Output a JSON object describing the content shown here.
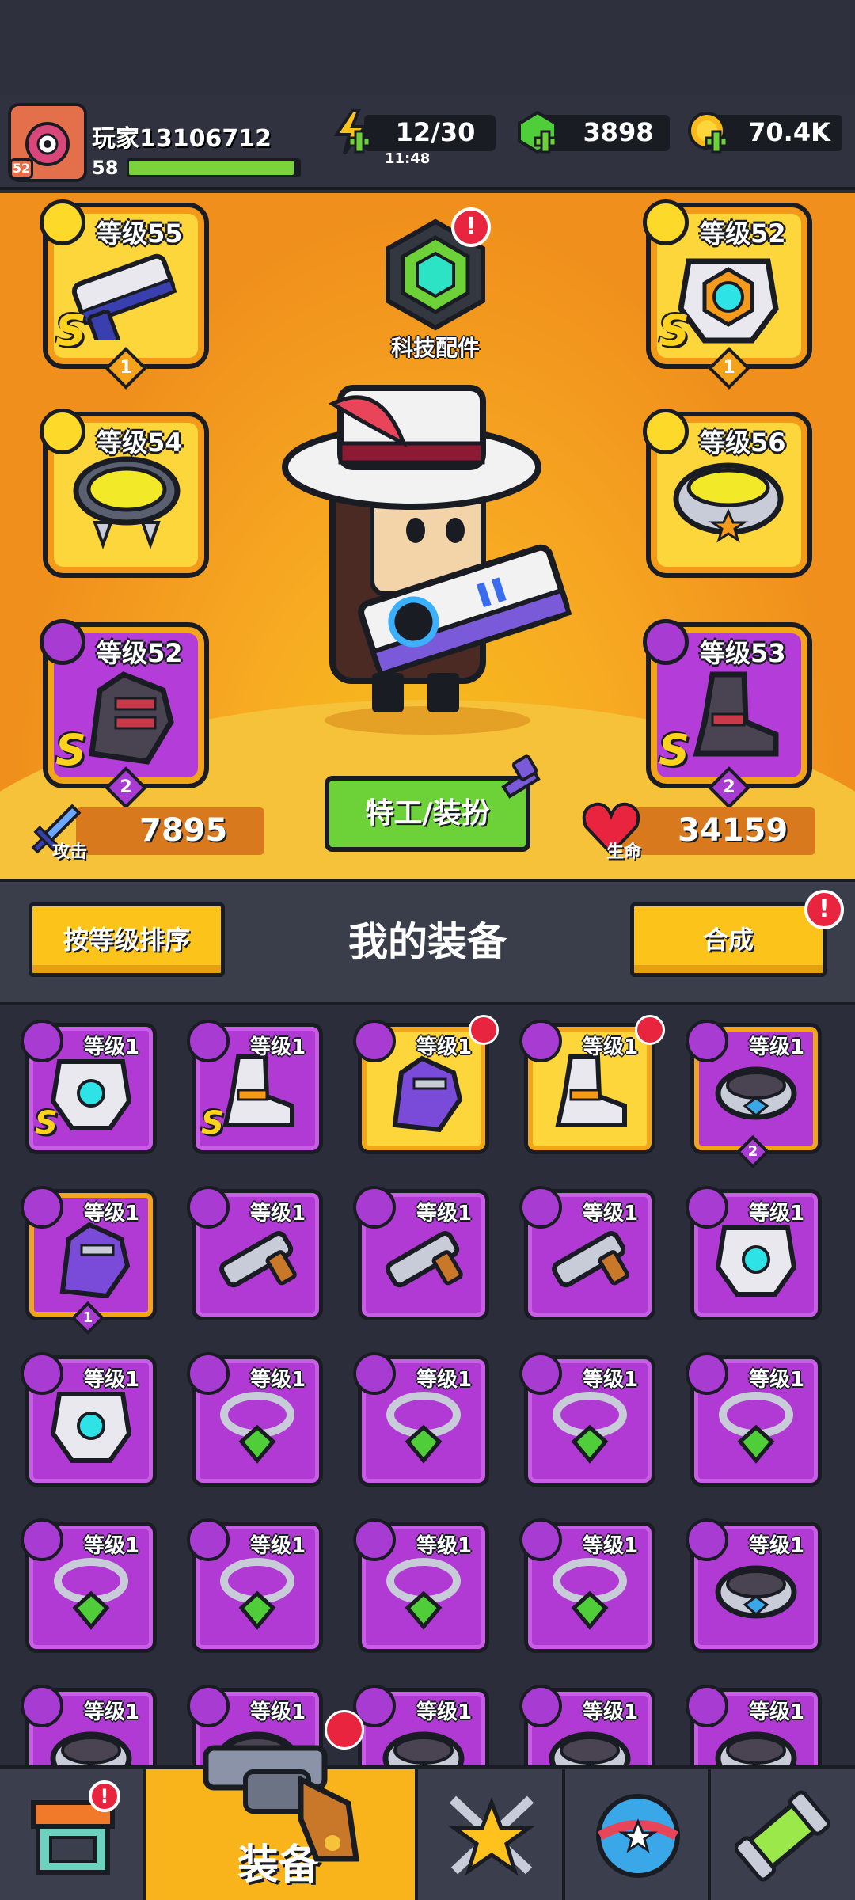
{
  "player": {
    "name": "玩家13106712",
    "level": "58",
    "avatar_level": "52",
    "xp_fraction": 0.97
  },
  "resources": {
    "energy": "12/30",
    "energy_timer": "11:48",
    "gems": "3898",
    "coins": "70.4K"
  },
  "tech_parts": {
    "label": "科技配件",
    "alert": "!"
  },
  "slots": {
    "weapon": {
      "label": "等级55",
      "grade": "S",
      "stars": "1"
    },
    "armor": {
      "label": "等级52",
      "grade": "S",
      "stars": "1"
    },
    "necklace": {
      "label": "等级54"
    },
    "belt": {
      "label": "等级56"
    },
    "gloves": {
      "label": "等级52",
      "grade": "S",
      "stars": "2"
    },
    "boots": {
      "label": "等级53",
      "grade": "S",
      "stars": "2"
    }
  },
  "stats": {
    "attack_label": "攻击",
    "attack_value": "7895",
    "health_label": "生命",
    "health_value": "34159"
  },
  "agent_button": "特工/装扮",
  "equipment": {
    "sort_button": "按等级排序",
    "title": "我的装备",
    "merge_button": "合成",
    "merge_alert": "!",
    "items": [
      {
        "label": "等级1",
        "type": "armor",
        "grade": "S"
      },
      {
        "label": "等级1",
        "type": "boots",
        "grade": "S"
      },
      {
        "label": "等级1",
        "type": "gloves",
        "badge": true
      },
      {
        "label": "等级1",
        "type": "boots",
        "badge": true
      },
      {
        "label": "等级1",
        "type": "belt",
        "stars": "2"
      },
      {
        "label": "等级1",
        "type": "gloves",
        "stars": "1"
      },
      {
        "label": "等级1",
        "type": "weapon"
      },
      {
        "label": "等级1",
        "type": "weapon"
      },
      {
        "label": "等级1",
        "type": "weapon"
      },
      {
        "label": "等级1",
        "type": "armor"
      },
      {
        "label": "等级1",
        "type": "armor"
      },
      {
        "label": "等级1",
        "type": "necklace"
      },
      {
        "label": "等级1",
        "type": "necklace"
      },
      {
        "label": "等级1",
        "type": "necklace"
      },
      {
        "label": "等级1",
        "type": "necklace"
      },
      {
        "label": "等级1",
        "type": "necklace"
      },
      {
        "label": "等级1",
        "type": "necklace"
      },
      {
        "label": "等级1",
        "type": "necklace"
      },
      {
        "label": "等级1",
        "type": "necklace"
      },
      {
        "label": "等级1",
        "type": "belt"
      },
      {
        "label": "等级1",
        "type": "belt"
      },
      {
        "label": "等级1",
        "type": "belt"
      },
      {
        "label": "等级1",
        "type": "belt"
      },
      {
        "label": "等级1",
        "type": "belt"
      },
      {
        "label": "等级1",
        "type": "belt"
      }
    ]
  },
  "nav": {
    "active_label": "装备",
    "shop_alert": "!"
  },
  "colors": {
    "hero_bg": "#f7a922",
    "purple_cell": "#b13ad4",
    "gold_cell": "#fcd63a",
    "green_button": "#6dd138",
    "yellow_button": "#fcc41a"
  }
}
